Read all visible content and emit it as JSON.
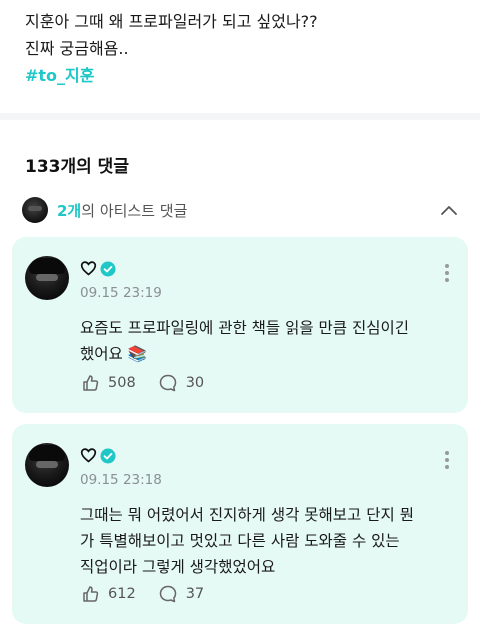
{
  "post": {
    "lines": [
      "지훈아 그때 왜 프로파일러가 되고 싶었나??",
      "진짜 궁금해욤.."
    ],
    "hashtag": "#to_지훈"
  },
  "comments": {
    "header": "133개의 댓글",
    "artist_bar": {
      "count_label": "2개",
      "suffix": "의 아티스트 댓글",
      "icon": "chevron-up-icon"
    }
  },
  "cards": [
    {
      "timestamp": "09.15 23:19",
      "body_lines": [
        "요즘도 프로파일링에 관한 책들 읽을 만큼 진심이긴",
        "했어요 📚"
      ],
      "likes": "508",
      "replies": "30"
    },
    {
      "timestamp": "09.15 23:18",
      "body_lines": [
        "그때는 뭐 어렸어서 진지하게 생각 못해보고 단지 뭔",
        "가 특별해보이고 멋있고 다른 사람 도와줄 수 있는",
        "직업이라 그렇게 생각했었어요"
      ],
      "likes": "612",
      "replies": "37"
    }
  ],
  "colors": {
    "accent": "#1fc7c7",
    "card_bg": "#e5f9f5",
    "muted": "#8a8f94"
  }
}
